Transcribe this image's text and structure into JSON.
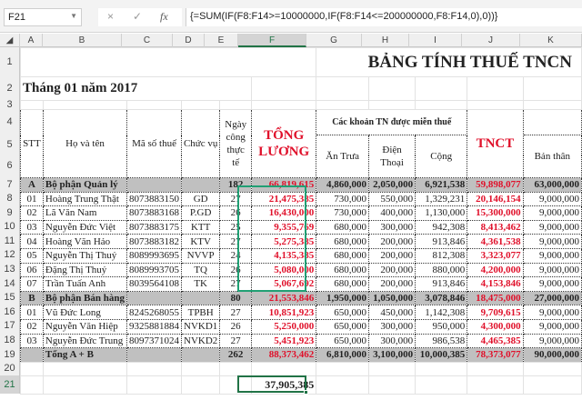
{
  "formula_bar": {
    "name_box": "F21",
    "cancel_icon": "×",
    "enter_icon": "✓",
    "fx": "fx",
    "formula": "{=SUM(IF(F8:F14>=10000000,IF(F8:F14<=200000000,F8:F14,0),0))}"
  },
  "columns": [
    "A",
    "B",
    "C",
    "D",
    "E",
    "F",
    "G",
    "H",
    "I",
    "J",
    "K"
  ],
  "rows": [
    "1",
    "2",
    "3",
    "4",
    "5",
    "6",
    "7",
    "8",
    "9",
    "10",
    "11",
    "12",
    "13",
    "14",
    "15",
    "16",
    "17",
    "18",
    "19",
    "20",
    "21"
  ],
  "title": "BẢNG TÍNH THUẾ TNCN",
  "month": "Tháng 01 năm 2017",
  "headers": {
    "stt": "STT",
    "name": "Họ và tên",
    "tax_code": "Mã số thuế",
    "position": "Chức vụ",
    "days": "Ngày công thực tế",
    "total": "TỔNG LƯƠNG",
    "exempt": "Các khoản TN được miễn thuế",
    "lunch": "Ăn Trưa",
    "phone": "Điện Thoại",
    "sum": "Cộng",
    "tnct": "TNCT",
    "self": "Bản thân"
  },
  "data_rows": [
    {
      "type": "group",
      "a": "A",
      "b": "Bộ phận Quản lý",
      "c": "",
      "d": "",
      "e": "182",
      "f": "66,819,615",
      "g": "4,860,000",
      "h": "2,050,000",
      "i": "6,921,538",
      "j": "59,898,077",
      "k": "63,000,000"
    },
    {
      "a": "01",
      "b": "Hoàng Trung Thật",
      "c": "8073883150",
      "d": "GD",
      "e": "27",
      "f": "21,475,385",
      "g": "730,000",
      "h": "550,000",
      "i": "1,329,231",
      "j": "20,146,154",
      "k": "9,000,000"
    },
    {
      "a": "02",
      "b": "Lã Văn Nam",
      "c": "8073883168",
      "d": "P.GD",
      "e": "26",
      "f": "16,430,000",
      "g": "730,000",
      "h": "400,000",
      "i": "1,130,000",
      "j": "15,300,000",
      "k": "9,000,000"
    },
    {
      "a": "03",
      "b": "Nguyễn Đức Việt",
      "c": "8073883175",
      "d": "KTT",
      "e": "25",
      "f": "9,355,769",
      "g": "680,000",
      "h": "300,000",
      "i": "942,308",
      "j": "8,413,462",
      "k": "9,000,000"
    },
    {
      "a": "04",
      "b": "Hoàng Văn Hảo",
      "c": "8073883182",
      "d": "KTV",
      "e": "27",
      "f": "5,275,385",
      "g": "680,000",
      "h": "200,000",
      "i": "913,846",
      "j": "4,361,538",
      "k": "9,000,000"
    },
    {
      "a": "05",
      "b": "Nguyễn Thị Thuý",
      "c": "8089993695",
      "d": "NVVP",
      "e": "24",
      "f": "4,135,385",
      "g": "680,000",
      "h": "200,000",
      "i": "812,308",
      "j": "3,323,077",
      "k": "9,000,000"
    },
    {
      "a": "06",
      "b": "Đặng Thị Thuý",
      "c": "8089993705",
      "d": "TQ",
      "e": "26",
      "f": "5,080,000",
      "g": "680,000",
      "h": "200,000",
      "i": "880,000",
      "j": "4,200,000",
      "k": "9,000,000"
    },
    {
      "a": "07",
      "b": "Trần Tuấn Anh",
      "c": "8039564108",
      "d": "TK",
      "e": "27",
      "f": "5,067,692",
      "g": "680,000",
      "h": "200,000",
      "i": "913,846",
      "j": "4,153,846",
      "k": "9,000,000"
    },
    {
      "type": "group",
      "a": "B",
      "b": "Bộ phận Bán hàng",
      "c": "",
      "d": "",
      "e": "80",
      "f": "21,553,846",
      "g": "1,950,000",
      "h": "1,050,000",
      "i": "3,078,846",
      "j": "18,475,000",
      "k": "27,000,000"
    },
    {
      "a": "01",
      "b": "Vũ Đức Long",
      "c": "8245268055",
      "d": "TPBH",
      "e": "27",
      "f": "10,851,923",
      "g": "650,000",
      "h": "450,000",
      "i": "1,142,308",
      "j": "9,709,615",
      "k": "9,000,000"
    },
    {
      "a": "02",
      "b": "Nguyễn Văn Hiệp",
      "c": "9325881884",
      "d": "NVKD1",
      "e": "26",
      "f": "5,250,000",
      "g": "650,000",
      "h": "300,000",
      "i": "950,000",
      "j": "4,300,000",
      "k": "9,000,000"
    },
    {
      "a": "03",
      "b": "Nguyễn Đức Trung",
      "c": "8097371024",
      "d": "NVKD2",
      "e": "27",
      "f": "5,451,923",
      "g": "650,000",
      "h": "300,000",
      "i": "986,538",
      "j": "4,465,385",
      "k": "9,000,000"
    },
    {
      "type": "group",
      "a": "",
      "b": "Tổng A + B",
      "c": "",
      "d": "",
      "e": "262",
      "f": "88,373,462",
      "g": "6,810,000",
      "h": "3,100,000",
      "i": "10,000,385",
      "j": "78,373,077",
      "k": "90,000,000"
    }
  ],
  "result": "37,905,385"
}
